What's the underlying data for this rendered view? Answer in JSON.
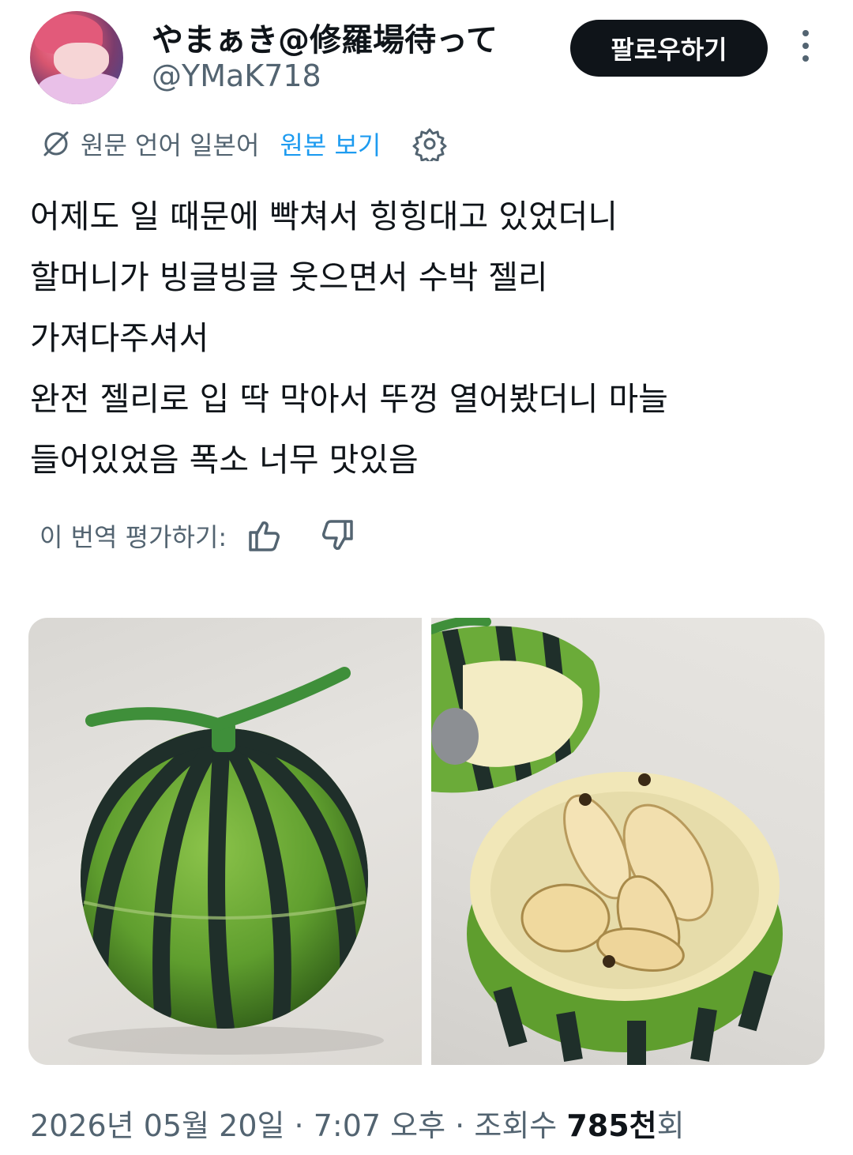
{
  "author": {
    "display_name": "やまぁき@修羅場待って",
    "handle": "@YMaK718"
  },
  "header": {
    "follow_label": "팔로우하기"
  },
  "translation": {
    "source_language": "원문 언어 일본어",
    "view_original": "원본 보기"
  },
  "tweet": {
    "lines": [
      "어제도 일 때문에 빡쳐서 힝힝대고 있었더니",
      "할머니가 빙글빙글 웃으면서 수박 젤리",
      "가져다주셔서",
      "완전 젤리로 입 딱 막아서 뚜껑 열어봤더니 마늘",
      "들어있었음 폭소 너무 맛있음"
    ]
  },
  "rating": {
    "label": "이 번역 평가하기:"
  },
  "media": {
    "left_alt": "watermelon-container-closed",
    "right_alt": "watermelon-container-open-with-garlic"
  },
  "meta": {
    "date": "2026년 05월 20일",
    "time": "7:07 오후",
    "views_prefix": "조회수",
    "views_count": "785천",
    "views_suffix": "회",
    "separator": "·"
  },
  "colors": {
    "text": "#0f1419",
    "muted": "#536471",
    "link": "#1d9bf0",
    "button_bg": "#0f1419"
  },
  "icons": [
    "translate-off-icon",
    "gear-icon",
    "thumbs-up-icon",
    "thumbs-down-icon",
    "more-vertical-icon"
  ]
}
